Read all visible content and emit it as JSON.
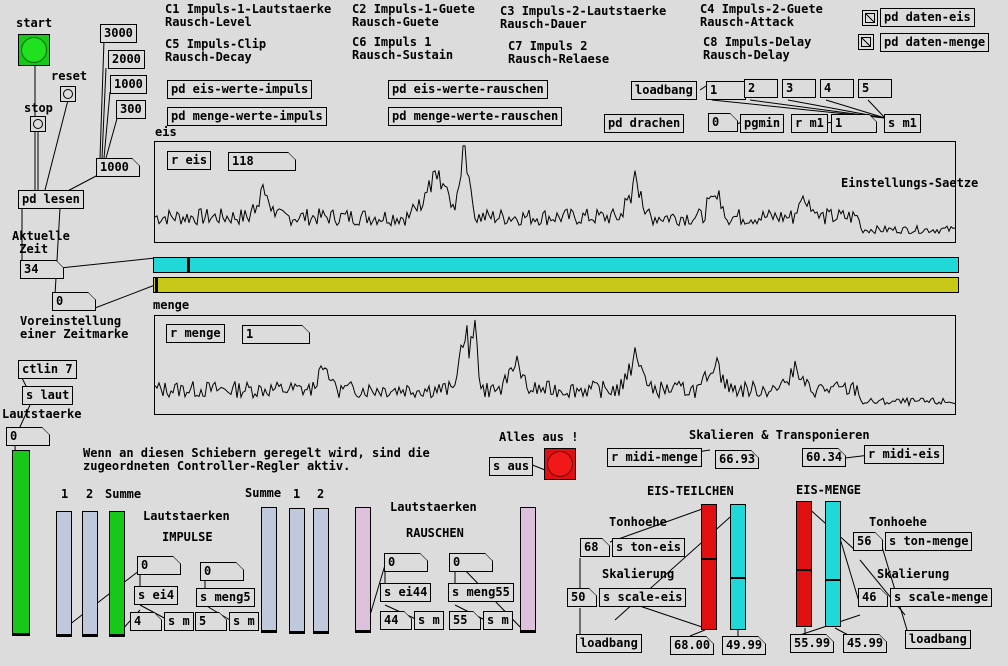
{
  "labels": {
    "start": "start",
    "reset": "reset",
    "stop": "stop",
    "aktuelle_zeit": "Aktuelle\n Zeit",
    "voreinstellung": "Voreinstellung\neiner Zeitmarke",
    "lautstaerke": "Lautstaerke",
    "eis": "eis",
    "menge": "menge",
    "einstellungs_saetze": "Einstellungs-Saetze",
    "hinweis": "Wenn an diesen Schiebern geregelt wird, sind die\nzugeordneten Controller-Regler aktiv.",
    "alles_aus": "Alles aus !",
    "skalieren": "Skalieren & Transponieren",
    "eis_teilchen": "EIS-TEILCHEN",
    "eis_menge": "EIS-MENGE",
    "tonhoehe_1": "Tonhoehe",
    "tonhoehe_2": "Tonhoehe",
    "skalierung_1": "Skalierung",
    "skalierung_2": "Skalierung",
    "col1_a": "1",
    "col2_a": "2",
    "summe_a": "Summe",
    "summe_b": "Summe",
    "col1_b": "1",
    "col2_b": "2",
    "lautst_impulse": "Lautstaerken",
    "impulse": "IMPULSE",
    "lautst_rauschen": "Lautstaerken",
    "rauschen": "RAUSCHEN"
  },
  "cc_legend": [
    {
      "code": "C1",
      "text": "Impuls-1-Lautstaerke\nRausch-Level"
    },
    {
      "code": "C2",
      "text": "Impuls-1-Guete\nRausch-Guete"
    },
    {
      "code": "C3",
      "text": "Impuls-2-Lautstaerke\nRausch-Dauer"
    },
    {
      "code": "C4",
      "text": "Impuls-2-Guete\nRausch-Attack"
    },
    {
      "code": "C5",
      "text": "Impuls-Clip\nRausch-Decay"
    },
    {
      "code": "C6",
      "text": "Impuls 1\nRausch-Sustain"
    },
    {
      "code": "C7",
      "text": "Impuls 2\nRausch-Relaese"
    },
    {
      "code": "C8",
      "text": "Impuls-Delay\nRausch-Delay"
    }
  ],
  "objects": {
    "pd_daten_eis": "pd daten-eis",
    "pd_daten_menge": "pd daten-menge",
    "pd_eis_werte_impuls": "pd eis-werte-impuls",
    "pd_menge_werte_impuls": "pd menge-werte-impuls",
    "pd_eis_werte_rauschen": "pd eis-werte-rauschen",
    "pd_menge_werte_rauschen": "pd menge-werte-rauschen",
    "loadbang_top": "loadbang",
    "pd_drachen": "pd drachen",
    "pgmin": "pgmin",
    "r_m1": "r m1",
    "s_m1": "s m1",
    "pd_lesen": "pd lesen",
    "r_eis": "r eis",
    "r_menge": "r menge",
    "ctlin": "ctlin 7",
    "s_laut": "s laut",
    "s_aus": "s aus",
    "r_midi_menge": "r midi-menge",
    "r_midi_eis": "r midi-eis",
    "s_ton_eis": "s ton-eis",
    "s_scale_eis": "s scale-eis",
    "s_ton_menge": "s ton-menge",
    "s_scale_menge": "s scale-menge",
    "loadbang_eis": "loadbang",
    "loadbang_menge": "loadbang",
    "s_ei4": "s ei4",
    "s_meng5": "s meng5",
    "s_ei44": "s ei44",
    "s_meng55": "s meng55",
    "s_m_a": "s m",
    "s_m_b": "s m",
    "s_m_c": "s m",
    "s_m_d": "s m"
  },
  "messages": {
    "m3000": "3000",
    "m2000": "2000",
    "m1000": "1000",
    "m300": "300",
    "m1": "1",
    "m2": "2",
    "m3": "3",
    "m4": "4",
    "m5": "5"
  },
  "numbers": {
    "n1000": "1000",
    "zeit": "34",
    "vor": "0",
    "eis_val": "118",
    "menge_val": "1",
    "laut": "0",
    "pg0": "0",
    "m1_val": "1",
    "skal_menge": "66.93",
    "skal_eis": "60.34",
    "ton_eis": "68",
    "scale_eis": "50",
    "ton_menge": "56",
    "scale_menge": "46",
    "eis_out_1": "68.00",
    "eis_out_2": "49.99",
    "menge_out_1": "55.99",
    "menge_out_2": "45.99",
    "i0a": "0",
    "i0b": "0",
    "i4": "4",
    "i5": "5",
    "r0a": "0",
    "r0b": "0",
    "r44": "44",
    "r55": "55"
  },
  "sliders": {
    "laut_level": 0.0,
    "imp1": 0.0,
    "imp2": 0.0,
    "imp_sum": 0.0,
    "menge_sum": 0.0,
    "menge1": 0.0,
    "menge2": 0.0,
    "rausch1": 0.0,
    "rausch2": 0.0,
    "eis_red_1": 0.56,
    "eis_cyan_2": 0.4,
    "menge_red_1": 0.44,
    "menge_cyan_2": 0.36,
    "zeit_h": 0.03,
    "vor_h": 0.0
  },
  "colors": {
    "cyan": "#20d8d8",
    "olive": "#c8c818",
    "lavender": "#c0c8dc",
    "pink": "#dcc0dc",
    "green": "#18c818",
    "red": "#e01010"
  }
}
